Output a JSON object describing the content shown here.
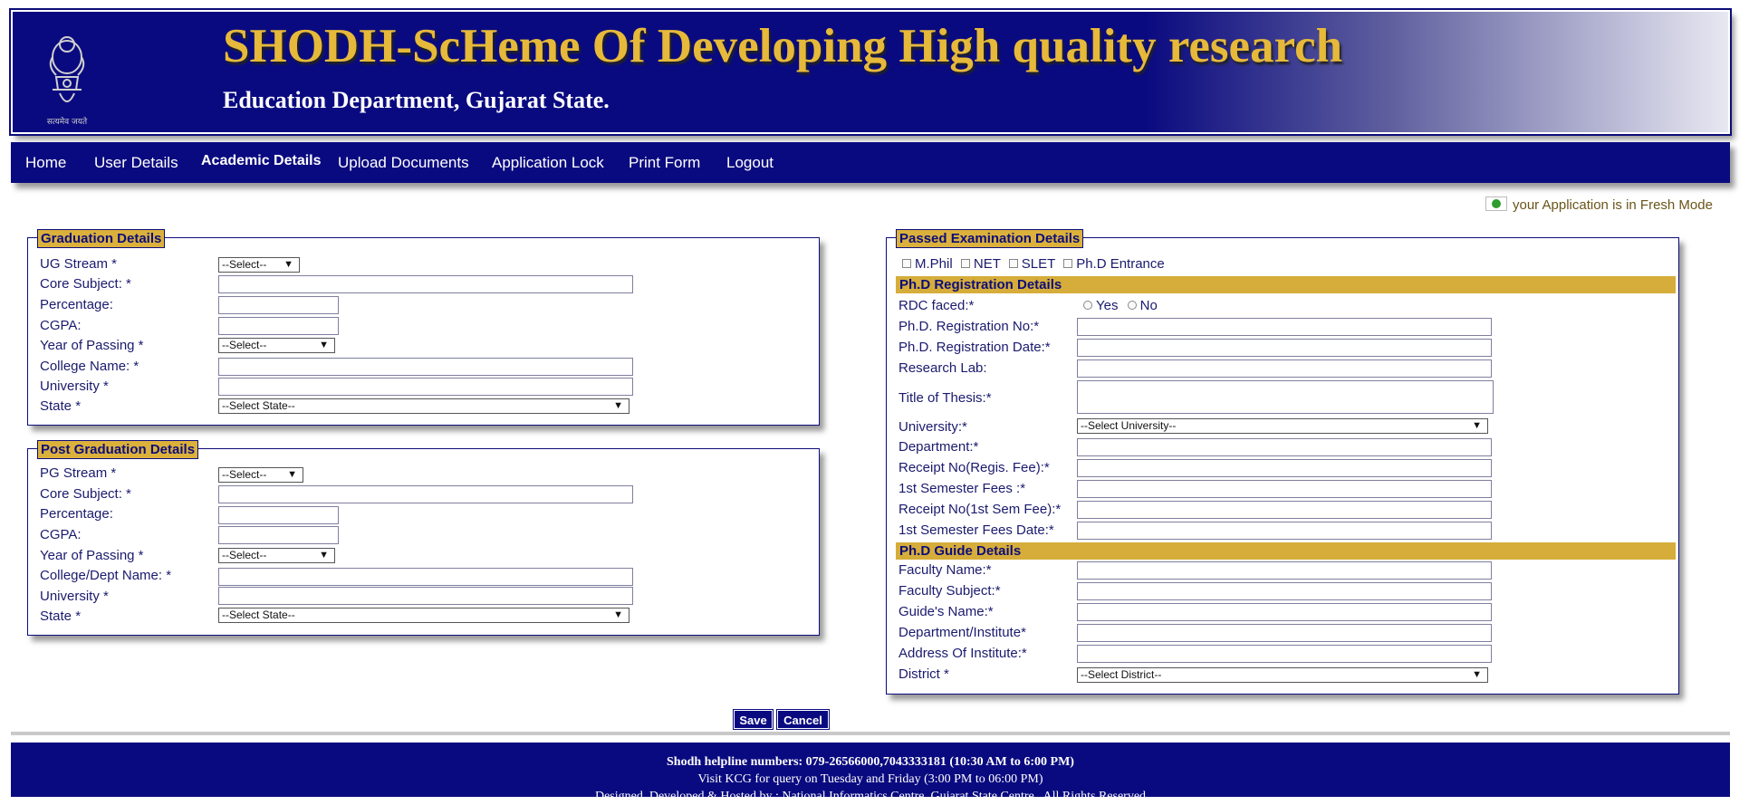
{
  "header": {
    "title": "SHODH-ScHeme Of Developing High quality research",
    "subtitle": "Education Department, Gujarat State.",
    "emblem_motto": "सत्यमेव जयते"
  },
  "nav": {
    "items": [
      "Home",
      "User Details",
      "Academic Details",
      "Upload Documents",
      "Application Lock",
      "Print Form",
      "Logout"
    ],
    "active": "Academic Details"
  },
  "status": {
    "mode_text": "your Application is in Fresh Mode"
  },
  "graduation": {
    "legend": "Graduation Details",
    "labels": [
      "UG Stream *",
      "Core Subject: *",
      "Percentage:",
      "CGPA:",
      "Year of Passing *",
      "College Name: *",
      "University *",
      "State *"
    ],
    "stream_select": "--Select--",
    "year_select": "--Select--",
    "state_select": "--Select State--"
  },
  "post_graduation": {
    "legend": "Post Graduation Details",
    "labels": [
      "PG Stream *",
      "Core Subject: *",
      "Percentage:",
      "CGPA:",
      "Year of Passing *",
      "College/Dept Name: *",
      "University *",
      "State *"
    ],
    "stream_select": "--Select--",
    "year_select": "--Select--",
    "state_select": "--Select State--"
  },
  "passed_exam": {
    "legend": "Passed Examination Details",
    "checkboxes": [
      "M.Phil",
      "NET",
      "SLET",
      "Ph.D Entrance"
    ]
  },
  "phd_registration": {
    "band": "Ph.D Registration Details",
    "rdc_label": "RDC faced:*",
    "rdc_options": [
      "Yes",
      "No"
    ],
    "labels": [
      "Ph.D. Registration No:*",
      "Ph.D. Registration Date:*",
      "Research Lab:",
      "Title of Thesis:*",
      "University:*",
      "Department:*",
      "Receipt No(Regis. Fee):*",
      "1st Semester Fees :*",
      "Receipt No(1st Sem Fee):*",
      "1st Semester Fees Date:*"
    ],
    "university_select": "--Select University--"
  },
  "phd_guide": {
    "band": "Ph.D Guide Details",
    "labels": [
      "Faculty Name:*",
      "Faculty Subject:*",
      "Guide's Name:*",
      "Department/Institute*",
      "Address Of Institute:*",
      "District *"
    ],
    "district_select": "--Select District--"
  },
  "buttons": {
    "save": "Save",
    "cancel": "Cancel"
  },
  "footer": {
    "line1": "Shodh helpline numbers: 079-26566000,7043333181 (10:30 AM to 6:00 PM)",
    "line2": "Visit KCG for query on Tuesday and Friday (3:00 PM to 06:00 PM)",
    "line3": "Designed, Developed & Hosted by : National Informatics Centre, Gujarat State Centre , All Rights Reserved"
  },
  "colors": {
    "navy": "#0a0a80",
    "gold": "#dbb13c",
    "title_gold": "#e6b93a"
  }
}
